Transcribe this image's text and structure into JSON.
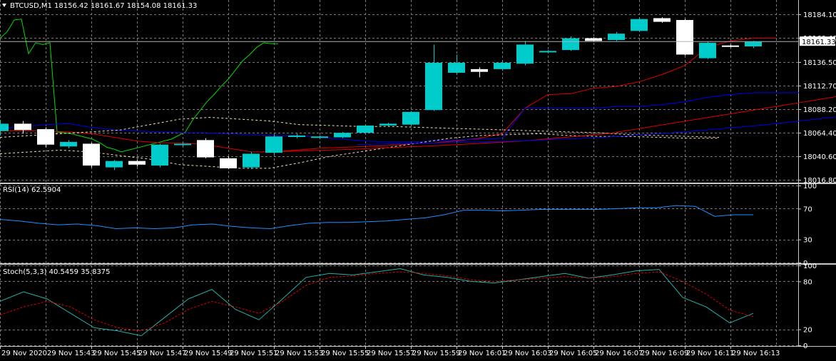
{
  "header": {
    "symbol": "BTCUSD,M1",
    "ohlc": "18156.42 18161.67 18154.08 18161.33"
  },
  "colors": {
    "background": "#000000",
    "grid": "#7a7a7a",
    "axis_text": "#ffffff",
    "bull_candle": "#00cccc",
    "bear_candle": "#ffffff",
    "ma_fast": "#00dd00",
    "ma_mid": "#dd0000",
    "ma_slow": "#0000ee",
    "envelope": "#f5deb3",
    "current_price_line": "#b0b0b0",
    "rsi_line": "#1e90ff",
    "stoch_main": "#20b2aa",
    "stoch_signal": "#dd0000"
  },
  "chart_data": [
    {
      "type": "candlestick",
      "panel": "price",
      "ylim": [
        18007,
        18196
      ],
      "yticks": [
        "18184.10",
        "18160.40",
        "18136.50",
        "18112.70",
        "18088.20",
        "18064.40",
        "18040.60",
        "18016.80"
      ],
      "current_price": "18161.33",
      "candles": [
        {
          "o": 18063,
          "c": 18071,
          "h": 18075,
          "l": 18058
        },
        {
          "o": 18071,
          "c": 18064,
          "h": 18074,
          "l": 18060
        },
        {
          "o": 18065,
          "c": 18048,
          "h": 18067,
          "l": 18045
        },
        {
          "o": 18046,
          "c": 18051,
          "h": 18053,
          "l": 18044
        },
        {
          "o": 18049,
          "c": 18025,
          "h": 18050,
          "l": 18023
        },
        {
          "o": 18023,
          "c": 18030,
          "h": 18031,
          "l": 18020
        },
        {
          "o": 18030,
          "c": 18026,
          "h": 18031,
          "l": 18024
        },
        {
          "o": 18025,
          "c": 18048,
          "h": 18049,
          "l": 18023
        },
        {
          "o": 18048,
          "c": 18049,
          "h": 18050,
          "l": 18046
        },
        {
          "o": 18053,
          "c": 18034,
          "h": 18055,
          "l": 18033
        },
        {
          "o": 18033,
          "c": 18022,
          "h": 18035,
          "l": 18021
        },
        {
          "o": 18023,
          "c": 18038,
          "h": 18040,
          "l": 18021
        },
        {
          "o": 18039,
          "c": 18057,
          "h": 18059,
          "l": 18037
        },
        {
          "o": 18057,
          "c": 18058,
          "h": 18060,
          "l": 18055
        },
        {
          "o": 18056,
          "c": 18057,
          "h": 18058,
          "l": 18054
        },
        {
          "o": 18056,
          "c": 18061,
          "h": 18062,
          "l": 18055
        },
        {
          "o": 18061,
          "c": 18069,
          "h": 18070,
          "l": 18060
        },
        {
          "o": 18069,
          "c": 18071,
          "h": 18072,
          "l": 18068
        },
        {
          "o": 18070,
          "c": 18084,
          "h": 18085,
          "l": 18069
        },
        {
          "o": 18086,
          "c": 18138,
          "h": 18158,
          "l": 18085
        },
        {
          "o": 18127,
          "c": 18138,
          "h": 18147,
          "l": 18125
        },
        {
          "o": 18131,
          "c": 18128,
          "h": 18133,
          "l": 18122
        },
        {
          "o": 18131,
          "c": 18138,
          "h": 18140,
          "l": 18129
        },
        {
          "o": 18137,
          "c": 18158,
          "h": 18162,
          "l": 18135
        },
        {
          "o": 18150,
          "c": 18151,
          "h": 18152,
          "l": 18149
        },
        {
          "o": 18152,
          "c": 18165,
          "h": 18167,
          "l": 18151
        },
        {
          "o": 18165,
          "c": 18162,
          "h": 18166,
          "l": 18161
        },
        {
          "o": 18163,
          "c": 18170,
          "h": 18172,
          "l": 18162
        },
        {
          "o": 18173,
          "c": 18186,
          "h": 18188,
          "l": 18172
        },
        {
          "o": 18187,
          "c": 18183,
          "h": 18188,
          "l": 18182
        },
        {
          "o": 18185,
          "c": 18147,
          "h": 18186,
          "l": 18146
        },
        {
          "o": 18143,
          "c": 18160,
          "h": 18161,
          "l": 18142
        },
        {
          "o": 18157,
          "c": 18156,
          "h": 18158,
          "l": 18155
        },
        {
          "o": 18156,
          "c": 18161,
          "h": 18162,
          "l": 18154
        }
      ],
      "overlays": {
        "ma_fast": [
          18165,
          18172,
          18185,
          18186,
          18148,
          18160,
          18158,
          18160,
          18062,
          18061,
          18060,
          18058,
          18056,
          18054,
          18050,
          18045,
          18043,
          18040,
          18042,
          18044,
          18046,
          18048,
          18050,
          18052,
          18054,
          18058,
          18062,
          18075,
          18085,
          18095,
          18103,
          18112,
          18120,
          18130,
          18140,
          18147,
          18155,
          18160,
          18159,
          18159
        ],
        "ma_mid": [
          18063,
          18063,
          18063,
          18062,
          18060,
          18056,
          18052,
          18050,
          18050,
          18048,
          18044,
          18040,
          18040,
          18042,
          18044,
          18045,
          18046,
          18047,
          18049,
          18050,
          18052,
          18055,
          18060,
          18088,
          18103,
          18104,
          18110,
          18112,
          18117,
          18125,
          18135,
          18155,
          18162,
          18165,
          18165
        ],
        "ma_slow": [
          18065,
          18068,
          18070,
          18071,
          18067,
          18064,
          18063,
          18062,
          18061,
          18061,
          18060,
          18059,
          18058,
          18058,
          18056,
          18054,
          18052,
          18051,
          18051,
          18052,
          18053,
          18054,
          18055,
          18088,
          18088,
          18088,
          18088,
          18090,
          18090,
          18092,
          18095,
          18100,
          18103,
          18105,
          18105,
          18105
        ],
        "slow_long_red": [
          18040,
          18043,
          18047,
          18052,
          18060,
          18075,
          18090,
          18105,
          18120,
          18135
        ],
        "slow_long_blue": [
          18048,
          18050,
          18052,
          18056,
          18062,
          18070,
          18080,
          18092,
          18102
        ],
        "envelope_upper": [
          18056,
          18058,
          18060,
          18062,
          18064,
          18070,
          18076,
          18078,
          18076,
          18074,
          18070,
          18069,
          18068,
          18068,
          18067,
          18066,
          18065,
          18064,
          18063,
          18062,
          18061,
          18059,
          18058,
          18057,
          18056
        ],
        "envelope_lower": [
          18038,
          18040,
          18042,
          18040,
          18036,
          18032,
          18026,
          18024,
          18022,
          18022,
          18028,
          18035,
          18040,
          18045,
          18050,
          18055,
          18058,
          18059,
          18060,
          18058,
          18057,
          18057,
          18056,
          18055,
          18055
        ]
      }
    },
    {
      "type": "line",
      "panel": "rsi",
      "title": "RSI(14) 62.5904",
      "ylim": [
        0,
        100
      ],
      "yticks": [
        "100",
        "70",
        "30",
        "0"
      ],
      "values": [
        56,
        54,
        51,
        49,
        50,
        48,
        44,
        45,
        44,
        45,
        49,
        50,
        47,
        45,
        44,
        48,
        51,
        52,
        52,
        53,
        54,
        56,
        58,
        62,
        68,
        68,
        67,
        68,
        69,
        69,
        69,
        69,
        70,
        71,
        71,
        74,
        73,
        60,
        62,
        62
      ]
    },
    {
      "type": "line",
      "panel": "stochastic",
      "title": "Stoch(5,3,3) 40.5459 35.8375",
      "ylim": [
        0,
        100
      ],
      "yticks": [
        "100",
        "80",
        "20",
        "0"
      ],
      "series": [
        {
          "name": "main",
          "values": [
            55,
            67,
            58,
            40,
            22,
            18,
            12,
            35,
            58,
            70,
            45,
            32,
            58,
            85,
            90,
            88,
            92,
            96,
            88,
            85,
            80,
            78,
            82,
            86,
            90,
            84,
            88,
            93,
            95,
            60,
            48,
            28,
            40
          ]
        },
        {
          "name": "signal",
          "values": [
            38,
            48,
            55,
            48,
            32,
            22,
            18,
            28,
            45,
            55,
            48,
            40,
            55,
            75,
            85,
            87,
            90,
            92,
            90,
            87,
            82,
            80,
            82,
            84,
            86,
            84,
            86,
            90,
            92,
            80,
            64,
            44,
            36
          ]
        }
      ]
    }
  ],
  "xaxis": {
    "labels": [
      "29 Nov 2020",
      "29 Nov 15:43",
      "29 Nov 15:45",
      "29 Nov 15:47",
      "29 Nov 15:49",
      "29 Nov 15:51",
      "29 Nov 15:53",
      "29 Nov 15:55",
      "29 Nov 15:57",
      "29 Nov 15:59",
      "29 Nov 16:01",
      "29 Nov 16:03",
      "29 Nov 16:05",
      "29 Nov 16:07",
      "29 Nov 16:09",
      "29 Nov 16:11",
      "29 Nov 16:13"
    ]
  }
}
